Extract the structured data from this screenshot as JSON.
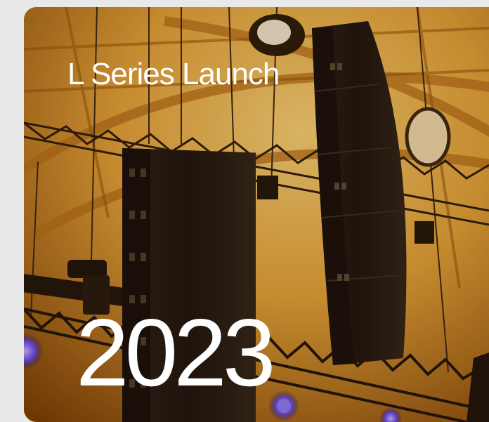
{
  "card": {
    "title": "L Series Launch",
    "year": "2023",
    "image": "concert-line-array-speakers",
    "colors": {
      "background": "#e9e9e9",
      "warm_light": "#f3b33c",
      "deep_amber": "#8a4a08",
      "speaker": "#1c1512",
      "stage_light": "#6a4cff",
      "text": "#ffffff"
    }
  }
}
